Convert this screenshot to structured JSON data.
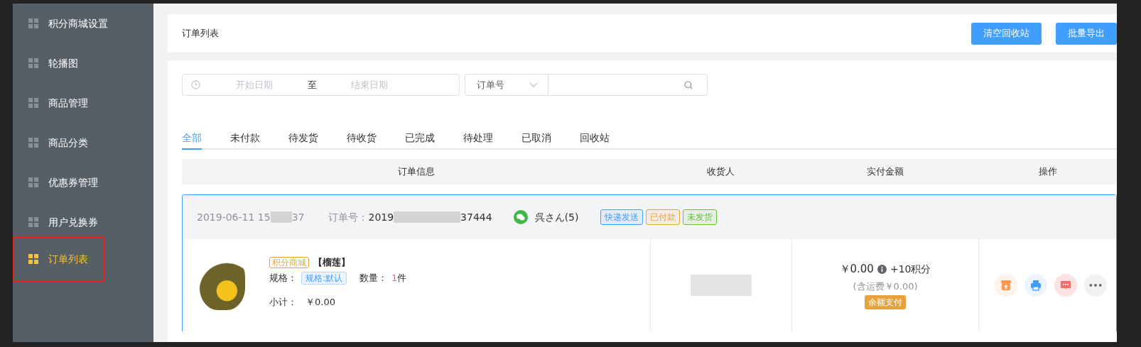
{
  "sidebar": {
    "items": [
      {
        "label": "积分商城设置",
        "selected": false
      },
      {
        "label": "轮播图",
        "selected": false
      },
      {
        "label": "商品管理",
        "selected": false
      },
      {
        "label": "商品分类",
        "selected": false
      },
      {
        "label": "优惠券管理",
        "selected": false
      },
      {
        "label": "用户兑换券",
        "selected": false
      },
      {
        "label": "订单列表",
        "selected": true
      }
    ]
  },
  "header": {
    "title": "订单列表",
    "buttons": [
      "清空回收站",
      "批量导出"
    ]
  },
  "filters": {
    "start_placeholder": "开始日期",
    "separator": "至",
    "end_placeholder": "结束日期",
    "search_type": "订单号"
  },
  "tabs": [
    {
      "label": "全部",
      "selected": true
    },
    {
      "label": "未付款",
      "selected": false
    },
    {
      "label": "待发货",
      "selected": false
    },
    {
      "label": "待收货",
      "selected": false
    },
    {
      "label": "已完成",
      "selected": false
    },
    {
      "label": "待处理",
      "selected": false
    },
    {
      "label": "已取消",
      "selected": false
    },
    {
      "label": "回收站",
      "selected": false
    }
  ],
  "table": {
    "columns": [
      "订单信息",
      "收货人",
      "实付金额",
      "操作"
    ]
  },
  "orders": [
    {
      "date_prefix": "2019-06-11 15",
      "date_suffix": "37",
      "order_label": "订单号：",
      "order_no_prefix": "2019",
      "order_no_suffix": "37444",
      "buyer": "呉さん(5)",
      "tags": [
        {
          "label": "快递发送",
          "color": "#409eff"
        },
        {
          "label": "已付款",
          "color": "#e6a23c"
        },
        {
          "label": "未发货",
          "color": "#67c23a"
        }
      ],
      "product": {
        "source_tag": "积分商城",
        "name": "【榴莲】",
        "spec_label": "规格：",
        "spec": "规格:默认",
        "qty_label": "数量：",
        "qty": "1",
        "qty_unit": "件",
        "subtotal_label": "小计：",
        "subtotal": "￥0.00"
      },
      "amount": "￥0.00",
      "points": "+10积分",
      "shipping": "(含运费￥0.00)",
      "payment": "余额支付",
      "actions": [
        {
          "kind": "ship"
        },
        {
          "kind": "print"
        },
        {
          "kind": "message"
        },
        {
          "kind": "more"
        }
      ]
    }
  ]
}
